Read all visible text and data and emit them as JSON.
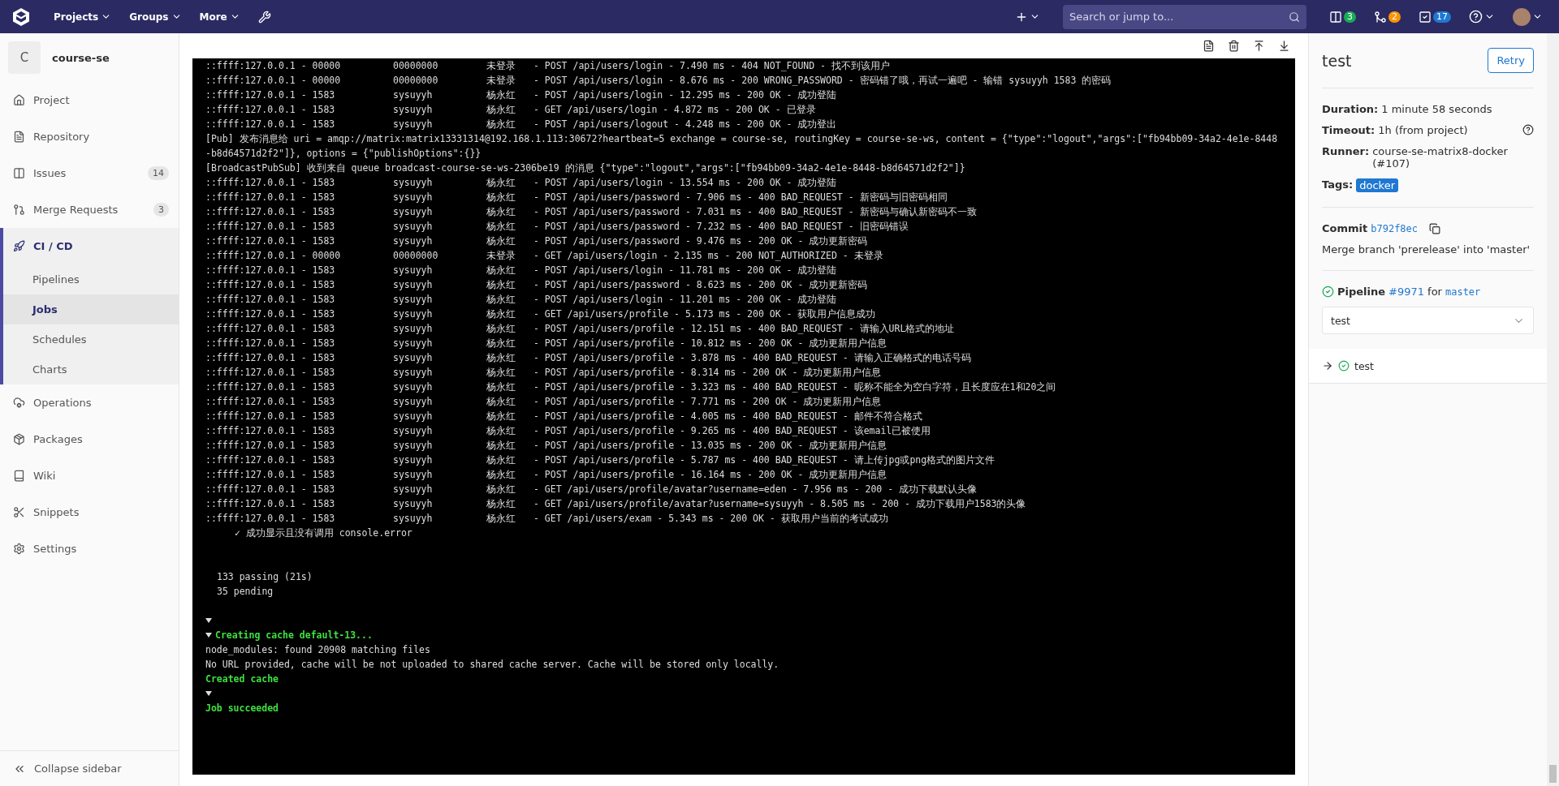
{
  "navbar": {
    "menus": [
      {
        "label": "Projects"
      },
      {
        "label": "Groups"
      },
      {
        "label": "More"
      }
    ],
    "search": {
      "placeholder": "Search or jump to..."
    },
    "counters": [
      {
        "count": "3",
        "color": "#1aaa55"
      },
      {
        "count": "2",
        "color": "#fc9403"
      },
      {
        "count": "17",
        "color": "#1f78d1"
      }
    ]
  },
  "sidebar": {
    "project": {
      "letter": "C",
      "name": "course-se"
    },
    "items": [
      {
        "label": "Project",
        "selected": false
      },
      {
        "label": "Repository",
        "selected": false
      },
      {
        "label": "Issues",
        "count": "14",
        "selected": false
      },
      {
        "label": "Merge Requests",
        "count": "3",
        "selected": false
      },
      {
        "label": "CI / CD",
        "selected": true,
        "children": [
          {
            "label": "Pipelines",
            "selected": false
          },
          {
            "label": "Jobs",
            "selected": true
          },
          {
            "label": "Schedules",
            "selected": false
          },
          {
            "label": "Charts",
            "selected": false
          }
        ]
      },
      {
        "label": "Operations",
        "selected": false
      },
      {
        "label": "Packages",
        "selected": false
      },
      {
        "label": "Wiki",
        "selected": false
      },
      {
        "label": "Snippets",
        "selected": false
      },
      {
        "label": "Settings",
        "selected": false
      }
    ],
    "collapse": "Collapse sidebar"
  },
  "log": [
    {
      "kind": "request",
      "addr": "::ffff:127.0.0.1 - 00000",
      "user": "00000000",
      "name": "未登录",
      "text": "- POST /api/users/login - 7.490 ms - 404 NOT_FOUND - 找不到该用户"
    },
    {
      "kind": "request",
      "addr": "::ffff:127.0.0.1 - 00000",
      "user": "00000000",
      "name": "未登录",
      "text": "- POST /api/users/login - 8.676 ms - 200 WRONG_PASSWORD - 密码错了哦，再试一遍吧 - 输错 sysuyyh 1583 的密码"
    },
    {
      "kind": "request",
      "addr": "::ffff:127.0.0.1 - 1583",
      "user": "sysuyyh",
      "name": "杨永红",
      "text": "- POST /api/users/login - 12.295 ms - 200 OK - 成功登陆"
    },
    {
      "kind": "request",
      "addr": "::ffff:127.0.0.1 - 1583",
      "user": "sysuyyh",
      "name": "杨永红",
      "text": "- GET /api/users/login - 4.872 ms - 200 OK - 已登录"
    },
    {
      "kind": "request",
      "addr": "::ffff:127.0.0.1 - 1583",
      "user": "sysuyyh",
      "name": "杨永红",
      "text": "- POST /api/users/logout - 4.248 ms - 200 OK - 成功登出"
    },
    {
      "kind": "plain",
      "text": "[Pub] 发布消息给 uri = amqp://matrix:matrix13331314@192.168.1.113:30672?heartbeat=5 exchange = course-se, routingKey = course-se-ws, content = {\"type\":\"logout\",\"args\":[\"fb94bb09-34a2-4e1e-8448-b8d64571d2f2\"]}, options = {\"publishOptions\":{}}"
    },
    {
      "kind": "plain",
      "text": "[BroadcastPubSub] 收到来自 queue broadcast-course-se-ws-2306be19 的消息 {\"type\":\"logout\",\"args\":[\"fb94bb09-34a2-4e1e-8448-b8d64571d2f2\"]}"
    },
    {
      "kind": "request",
      "addr": "::ffff:127.0.0.1 - 1583",
      "user": "sysuyyh",
      "name": "杨永红",
      "text": "- POST /api/users/login - 13.554 ms - 200 OK - 成功登陆"
    },
    {
      "kind": "request",
      "addr": "::ffff:127.0.0.1 - 1583",
      "user": "sysuyyh",
      "name": "杨永红",
      "text": "- POST /api/users/password - 7.906 ms - 400 BAD_REQUEST - 新密码与旧密码相同"
    },
    {
      "kind": "request",
      "addr": "::ffff:127.0.0.1 - 1583",
      "user": "sysuyyh",
      "name": "杨永红",
      "text": "- POST /api/users/password - 7.031 ms - 400 BAD_REQUEST - 新密码与确认新密码不一致"
    },
    {
      "kind": "request",
      "addr": "::ffff:127.0.0.1 - 1583",
      "user": "sysuyyh",
      "name": "杨永红",
      "text": "- POST /api/users/password - 7.232 ms - 400 BAD_REQUEST - 旧密码错误"
    },
    {
      "kind": "request",
      "addr": "::ffff:127.0.0.1 - 1583",
      "user": "sysuyyh",
      "name": "杨永红",
      "text": "- POST /api/users/password - 9.476 ms - 200 OK - 成功更新密码"
    },
    {
      "kind": "request",
      "addr": "::ffff:127.0.0.1 - 00000",
      "user": "00000000",
      "name": "未登录",
      "text": "- GET /api/users/login - 2.135 ms - 200 NOT_AUTHORIZED - 未登录"
    },
    {
      "kind": "request",
      "addr": "::ffff:127.0.0.1 - 1583",
      "user": "sysuyyh",
      "name": "杨永红",
      "text": "- POST /api/users/login - 11.781 ms - 200 OK - 成功登陆"
    },
    {
      "kind": "request",
      "addr": "::ffff:127.0.0.1 - 1583",
      "user": "sysuyyh",
      "name": "杨永红",
      "text": "- POST /api/users/password - 8.623 ms - 200 OK - 成功更新密码"
    },
    {
      "kind": "request",
      "addr": "::ffff:127.0.0.1 - 1583",
      "user": "sysuyyh",
      "name": "杨永红",
      "text": "- POST /api/users/login - 11.201 ms - 200 OK - 成功登陆"
    },
    {
      "kind": "request",
      "addr": "::ffff:127.0.0.1 - 1583",
      "user": "sysuyyh",
      "name": "杨永红",
      "text": "- GET /api/users/profile - 5.173 ms - 200 OK - 获取用户信息成功"
    },
    {
      "kind": "request",
      "addr": "::ffff:127.0.0.1 - 1583",
      "user": "sysuyyh",
      "name": "杨永红",
      "text": "- POST /api/users/profile - 12.151 ms - 400 BAD_REQUEST - 请输入URL格式的地址"
    },
    {
      "kind": "request",
      "addr": "::ffff:127.0.0.1 - 1583",
      "user": "sysuyyh",
      "name": "杨永红",
      "text": "- POST /api/users/profile - 10.812 ms - 200 OK - 成功更新用户信息"
    },
    {
      "kind": "request",
      "addr": "::ffff:127.0.0.1 - 1583",
      "user": "sysuyyh",
      "name": "杨永红",
      "text": "- POST /api/users/profile - 3.878 ms - 400 BAD_REQUEST - 请输入正确格式的电话号码"
    },
    {
      "kind": "request",
      "addr": "::ffff:127.0.0.1 - 1583",
      "user": "sysuyyh",
      "name": "杨永红",
      "text": "- POST /api/users/profile - 8.314 ms - 200 OK - 成功更新用户信息"
    },
    {
      "kind": "request",
      "addr": "::ffff:127.0.0.1 - 1583",
      "user": "sysuyyh",
      "name": "杨永红",
      "text": "- POST /api/users/profile - 3.323 ms - 400 BAD_REQUEST - 昵称不能全为空白字符，且长度应在1和20之间"
    },
    {
      "kind": "request",
      "addr": "::ffff:127.0.0.1 - 1583",
      "user": "sysuyyh",
      "name": "杨永红",
      "text": "- POST /api/users/profile - 7.771 ms - 200 OK - 成功更新用户信息"
    },
    {
      "kind": "request",
      "addr": "::ffff:127.0.0.1 - 1583",
      "user": "sysuyyh",
      "name": "杨永红",
      "text": "- POST /api/users/profile - 4.005 ms - 400 BAD_REQUEST - 邮件不符合格式"
    },
    {
      "kind": "request",
      "addr": "::ffff:127.0.0.1 - 1583",
      "user": "sysuyyh",
      "name": "杨永红",
      "text": "- POST /api/users/profile - 9.265 ms - 400 BAD_REQUEST - 该email已被使用"
    },
    {
      "kind": "request",
      "addr": "::ffff:127.0.0.1 - 1583",
      "user": "sysuyyh",
      "name": "杨永红",
      "text": "- POST /api/users/profile - 13.035 ms - 200 OK - 成功更新用户信息"
    },
    {
      "kind": "request",
      "addr": "::ffff:127.0.0.1 - 1583",
      "user": "sysuyyh",
      "name": "杨永红",
      "text": "- POST /api/users/profile - 5.787 ms - 400 BAD_REQUEST - 请上传jpg或png格式的图片文件"
    },
    {
      "kind": "request",
      "addr": "::ffff:127.0.0.1 - 1583",
      "user": "sysuyyh",
      "name": "杨永红",
      "text": "- POST /api/users/profile - 16.164 ms - 200 OK - 成功更新用户信息"
    },
    {
      "kind": "request",
      "addr": "::ffff:127.0.0.1 - 1583",
      "user": "sysuyyh",
      "name": "杨永红",
      "text": "- GET /api/users/profile/avatar?username=eden - 7.956 ms - 200 - 成功下载默认头像"
    },
    {
      "kind": "request",
      "addr": "::ffff:127.0.0.1 - 1583",
      "user": "sysuyyh",
      "name": "杨永红",
      "text": "- GET /api/users/profile/avatar?username=sysuyyh - 8.505 ms - 200 - 成功下载用户1583的头像"
    },
    {
      "kind": "request",
      "addr": "::ffff:127.0.0.1 - 1583",
      "user": "sysuyyh",
      "name": "杨永红",
      "text": "- GET /api/users/exam - 5.343 ms - 200 OK - 获取用户当前的考试成功"
    },
    {
      "kind": "test",
      "text": "✓ 成功显示且没有调用 console.error"
    },
    {
      "kind": "blank"
    },
    {
      "kind": "blank"
    },
    {
      "kind": "summary",
      "text": "133 passing (21s)"
    },
    {
      "kind": "summary",
      "text": "35 pending"
    },
    {
      "kind": "blank"
    },
    {
      "kind": "caret"
    },
    {
      "kind": "section",
      "text": "Creating cache default-13..."
    },
    {
      "kind": "plain",
      "text": "node_modules: found 20908 matching files"
    },
    {
      "kind": "plain",
      "text": "No URL provided, cache will be not uploaded to shared cache server. Cache will be stored only locally."
    },
    {
      "kind": "green",
      "text": "Created cache"
    },
    {
      "kind": "caret"
    },
    {
      "kind": "green",
      "text": "Job succeeded"
    }
  ],
  "job": {
    "title": "test",
    "retry": "Retry",
    "details": [
      {
        "label": "Duration:",
        "value": "1 minute 58 seconds"
      },
      {
        "label": "Timeout:",
        "value": "1h (from project)",
        "help": true
      },
      {
        "label": "Runner:",
        "value": "course-se-matrix8-docker (#107)"
      }
    ],
    "tags_label": "Tags:",
    "tags": [
      "docker"
    ],
    "commit": {
      "label": "Commit",
      "sha": "b792f8ec",
      "message": "Merge branch 'prerelease' into 'master'"
    },
    "pipeline": {
      "label": "Pipeline",
      "id": "#9971",
      "for": "for",
      "ref": "master"
    },
    "stage": "test",
    "jobs": [
      {
        "name": "test",
        "selected": true
      }
    ]
  }
}
